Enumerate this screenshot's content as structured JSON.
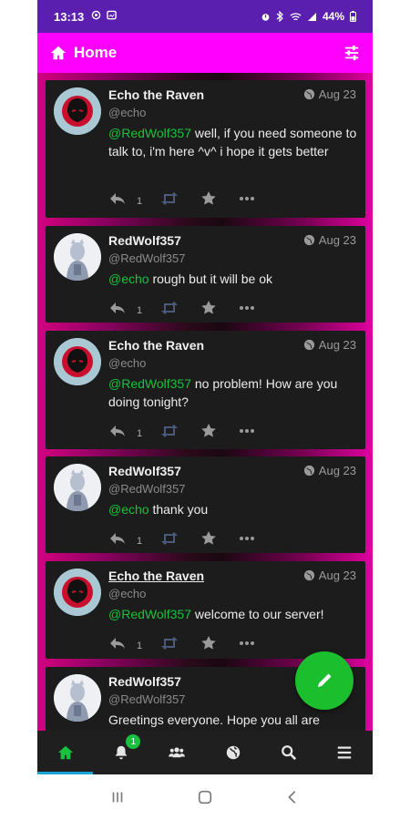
{
  "status_bar": {
    "time": "13:13",
    "battery": "44%",
    "left_icons": [
      "circle-icon",
      "image-icon"
    ],
    "right_icons": [
      "alarm-icon",
      "bluetooth-icon",
      "wifi-icon",
      "signal-icon",
      "battery-icon"
    ]
  },
  "app_bar": {
    "title": "Home",
    "icon": "home-icon",
    "action_icon": "filter-sliders-icon"
  },
  "colors": {
    "app_bar": "#ff00ff",
    "status_bar": "#5b1fb0",
    "mention": "#19c23e",
    "fab": "#1bbf2e",
    "tab_indicator": "#1aa4d8",
    "post_bg": "#1c1c1c"
  },
  "posts": [
    {
      "display_name": "Echo the Raven",
      "handle": "@echo",
      "date": "Aug 23",
      "mention": "@RedWolf357",
      "text": " well, if you need someone to talk to, i'm here ^v^ i hope it gets better",
      "reply_count": "1"
    },
    {
      "display_name": "RedWolf357",
      "handle": "@RedWolf357",
      "date": "Aug 23",
      "mention": "@echo",
      "text": " rough but it will be ok",
      "reply_count": "1"
    },
    {
      "display_name": "Echo the Raven",
      "handle": "@echo",
      "date": "Aug 23",
      "mention": "@RedWolf357",
      "text": " no problem! How are you doing tonight?",
      "reply_count": "1"
    },
    {
      "display_name": "RedWolf357",
      "handle": "@RedWolf357",
      "date": "Aug 23",
      "mention": "@echo",
      "text": " thank you",
      "reply_count": "1"
    },
    {
      "display_name": "Echo the Raven",
      "handle": "@echo",
      "date": "Aug 23",
      "mention": "@RedWolf357",
      "text": " welcome to our server!",
      "reply_count": "1"
    },
    {
      "display_name": "RedWolf357",
      "handle": "@RedWolf357",
      "date": "",
      "mention": "",
      "text": "Greetings everyone. Hope you all are",
      "reply_count": ""
    }
  ],
  "fab": {
    "icon": "pencil-icon"
  },
  "tab_bar": {
    "tabs": [
      "home-icon",
      "bell-icon",
      "users-icon",
      "globe-icon",
      "search-icon",
      "menu-icon"
    ],
    "notifications_badge": "1",
    "active": "home"
  },
  "nav_bar": {
    "buttons": [
      "recents-icon",
      "home-circle-icon",
      "back-chevron-icon"
    ]
  }
}
